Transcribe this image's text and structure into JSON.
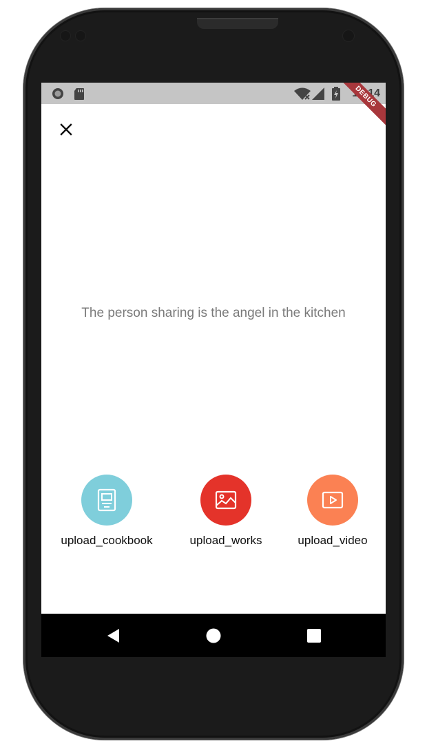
{
  "status_bar": {
    "time": "10:14",
    "debug_banner": "DEBUG"
  },
  "main": {
    "tagline": "The person sharing is the angel in the kitchen"
  },
  "actions": [
    {
      "label": "upload_cookbook",
      "icon": "cookbook-icon",
      "color": "#7fcedb"
    },
    {
      "label": "upload_works",
      "icon": "image-icon",
      "color": "#e4332a"
    },
    {
      "label": "upload_video",
      "icon": "video-icon",
      "color": "#fb8153"
    }
  ],
  "navigation": {
    "buttons": [
      "back-icon",
      "home-icon",
      "recents-icon"
    ]
  }
}
